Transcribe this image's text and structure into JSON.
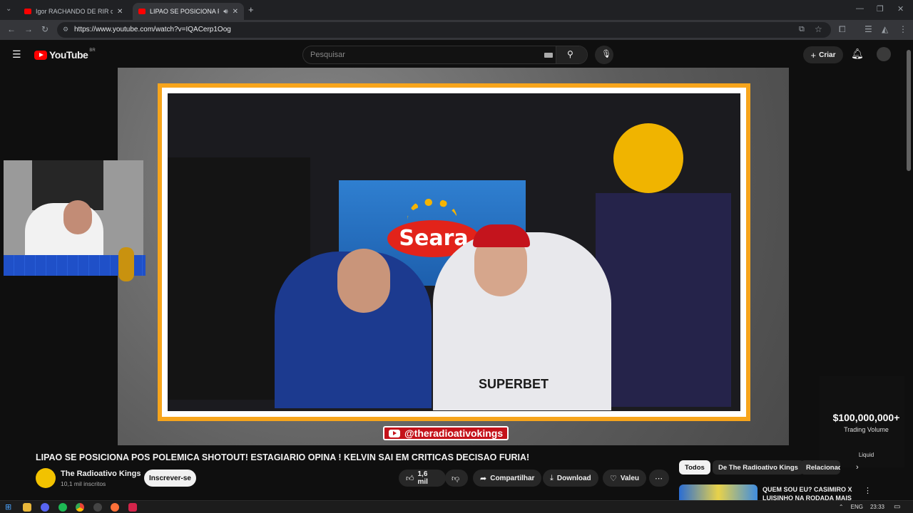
{
  "browser": {
    "tabs": [
      {
        "title": "Igor RACHANDO DE RIR com o",
        "active": false
      },
      {
        "title": "LIPAO SE POSICIONA POS P",
        "active": true
      }
    ],
    "new_tab": "+",
    "url": "https://www.youtube.com/watch?v=IQACerp1Oog"
  },
  "youtube": {
    "logo_text": "YouTube",
    "region": "BR",
    "search_placeholder": "Pesquisar",
    "create_label": "Criar"
  },
  "video": {
    "overlay_handle": "@theradioativokings",
    "title": "LIPAO SE POSICIONA POS POLEMICA SHOTOUT! ESTAGIARIO OPINA ! KELVIN SAI EM CRITICAS DECISAO FURIA!",
    "channel_name": "The Radioativo Kings",
    "subscribers": "10,1 mil inscritos",
    "subscribe_label": "Inscrever-se",
    "likes": "1,6 mil",
    "share_label": "Compartilhar",
    "download_label": "Download",
    "thanks_label": "Valeu"
  },
  "tv_brand": "Seara",
  "jersey_text": "SUPERBET",
  "ad": {
    "amount": "$100,000,000+",
    "caption": "Trading Volume",
    "brand": "Liquid"
  },
  "chips": [
    "Todos",
    "De The Radioativo Kings",
    "Relacionados"
  ],
  "recommendation": {
    "title": "QUEM SOU EU? CASIMIRO X LUISINHO NA RODADA MAIS"
  },
  "taskbar": {
    "language": "ENG",
    "time": "23:33"
  },
  "colors": {
    "frame_orange": "#f7a51c",
    "youtube_red": "#ff0000",
    "handle_red": "#c4121a"
  }
}
